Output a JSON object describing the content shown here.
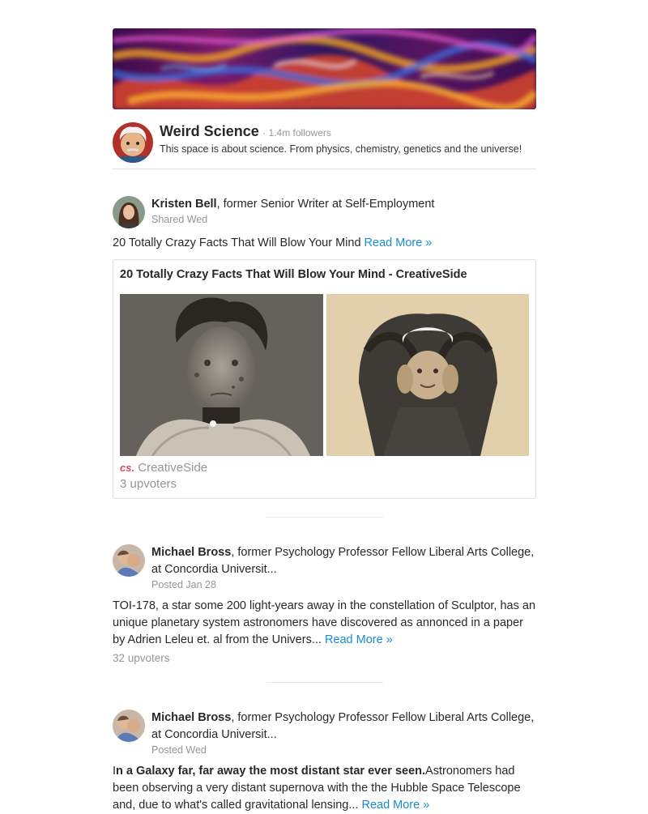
{
  "space": {
    "title": "Weird Science",
    "followers": "· 1.4m followers",
    "description": "This space is about science. From physics, chemistry, genetics and the universe!"
  },
  "posts": [
    {
      "author_name": "Kristen Bell",
      "author_credential": ", former Senior Writer at Self-Employment",
      "meta": "Shared Wed",
      "body": "20 Totally Crazy Facts That Will Blow Your Mind ",
      "read_more": "Read More »",
      "card": {
        "title": "20 Totally Crazy Facts That Will Blow Your Mind - CreativeSide",
        "source_logo": "cs.",
        "source_name": "CreativeSide",
        "upvoters": "3 upvoters"
      }
    },
    {
      "author_name": "Michael Bross",
      "author_credential": ", former Psychology Professor Fellow Liberal Arts College, at Concordia Universit...",
      "meta": "Posted Jan 28",
      "body": "TOI-178, a star some 200 light-years away in the constellation of Sculptor, has an unique planetary system astronomers have discovered as annonced in a paper by Adrien Leleu et. al from the Univers... ",
      "read_more": "Read More »",
      "upvoters": "32 upvoters"
    },
    {
      "author_name": "Michael Bross",
      "author_credential": ", former Psychology Professor Fellow Liberal Arts College, at Concordia Universit...",
      "meta": "Posted Wed",
      "body_prefix": "I",
      "body_bold": "n a Galaxy far, far away the most distant star ever seen.",
      "body": "Astronomers had been observing a very distant supernova with the the Hubble Space Telescope and, due to what's called gravitational lensing... ",
      "read_more": "Read More »"
    }
  ]
}
